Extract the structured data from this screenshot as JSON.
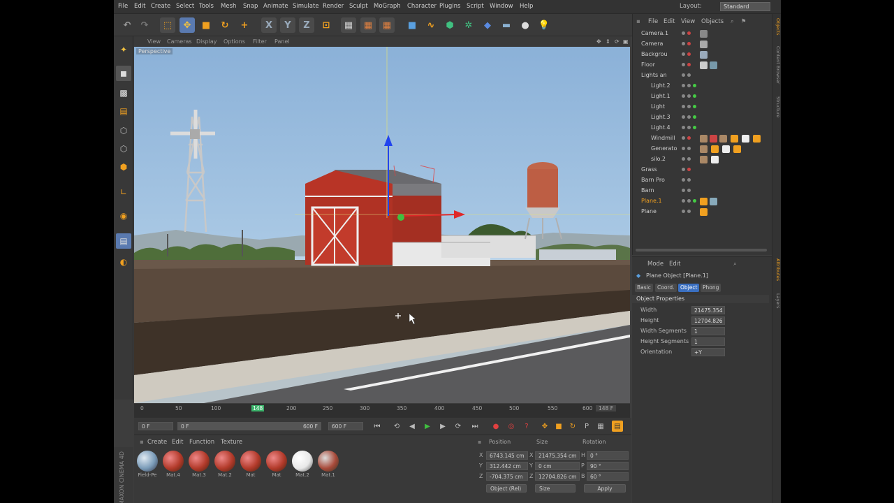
{
  "menu": [
    "File",
    "Edit",
    "Create",
    "Select",
    "Tools",
    "Mesh",
    "Snap",
    "Animate",
    "Simulate",
    "Render",
    "Sculpt",
    "MoGraph",
    "Character",
    "Plugins",
    "Script",
    "Window",
    "Help"
  ],
  "layout": {
    "label": "Layout:",
    "value": "Standard"
  },
  "viewport": {
    "menu": [
      "View",
      "Cameras",
      "Display",
      "Options",
      "Filter",
      "Panel"
    ],
    "camera_label": "Perspective"
  },
  "timeline": {
    "ticks": [
      "0",
      "50",
      "100",
      "148",
      "200",
      "250",
      "300",
      "350",
      "400",
      "450",
      "500",
      "550",
      "600"
    ],
    "current_frame": "148 F",
    "start_field": "0 F",
    "range_start": "0 F",
    "range_end": "600 F",
    "end_field": "600 F"
  },
  "materials": {
    "menu": [
      "Create",
      "Edit",
      "Function",
      "Texture"
    ],
    "items": [
      {
        "name": "Field-Pe",
        "color": "#7a9bb8"
      },
      {
        "name": "Mat.4",
        "color": "#b23a2a"
      },
      {
        "name": "Mat.3",
        "color": "#b23a2a"
      },
      {
        "name": "Mat.2",
        "color": "#b23a2a"
      },
      {
        "name": "Mat",
        "color": "#b23a2a"
      },
      {
        "name": "Mat",
        "color": "#b23a2a"
      },
      {
        "name": "Mat.2",
        "color": "#e8e8e8"
      },
      {
        "name": "Mat.1",
        "color": "#a84a3a"
      }
    ],
    "brand": "MAXON CINEMA 4D"
  },
  "coordinates": {
    "headers": [
      "Position",
      "Size",
      "Rotation"
    ],
    "rows": [
      {
        "axis": "X",
        "pos": "6743.145 cm",
        "size_axis": "X",
        "size": "21475.354 cm",
        "rot_axis": "H",
        "rot": "0 °"
      },
      {
        "axis": "Y",
        "pos": "312.442 cm",
        "size_axis": "Y",
        "size": "0 cm",
        "rot_axis": "P",
        "rot": "90 °"
      },
      {
        "axis": "Z",
        "pos": "-704.375 cm",
        "size_axis": "Z",
        "size": "12704.826 cm",
        "rot_axis": "B",
        "rot": "60 °"
      }
    ],
    "mode_select": "Object (Rel)",
    "size_select": "Size",
    "apply_label": "Apply"
  },
  "objects": {
    "menu": [
      "File",
      "Edit",
      "View",
      "Objects"
    ],
    "rows": [
      {
        "name": "Camera.1",
        "indent": 0
      },
      {
        "name": "Camera",
        "indent": 0
      },
      {
        "name": "Backgrou",
        "indent": 0
      },
      {
        "name": "Floor",
        "indent": 0
      },
      {
        "name": "Lights an",
        "indent": 0
      },
      {
        "name": "Light.2",
        "indent": 1
      },
      {
        "name": "Light.1",
        "indent": 1
      },
      {
        "name": "Light",
        "indent": 1
      },
      {
        "name": "Light.3",
        "indent": 1
      },
      {
        "name": "Light.4",
        "indent": 1
      },
      {
        "name": "Windmill",
        "indent": 0
      },
      {
        "name": "Generato",
        "indent": 0
      },
      {
        "name": "silo.2",
        "indent": 0
      },
      {
        "name": "Grass",
        "indent": 0
      },
      {
        "name": "Barn Pro",
        "indent": 0
      },
      {
        "name": "Barn",
        "indent": 0
      },
      {
        "name": "Plane.1",
        "indent": 0
      },
      {
        "name": "Plane",
        "indent": 0
      }
    ]
  },
  "attributes": {
    "menu": [
      "Mode",
      "Edit"
    ],
    "title": "Plane Object [Plane.1]",
    "tabs": [
      "Basic",
      "Coord.",
      "Object",
      "Phong"
    ],
    "section": "Object Properties",
    "props": [
      {
        "label": "Width",
        "value": "21475.354 "
      },
      {
        "label": "Height",
        "value": "12704.826 "
      },
      {
        "label": "Width Segments",
        "value": "1"
      },
      {
        "label": "Height Segments",
        "value": "1"
      },
      {
        "label": "Orientation",
        "value": "+Y"
      }
    ]
  },
  "side_tabs": [
    "Objects",
    "Content Browser",
    "Structure",
    "Attributes",
    "Layers"
  ],
  "colors": {
    "accent": "#f0a020",
    "selected": "#4a7fd0",
    "active_tab": "#3a6fc0"
  }
}
